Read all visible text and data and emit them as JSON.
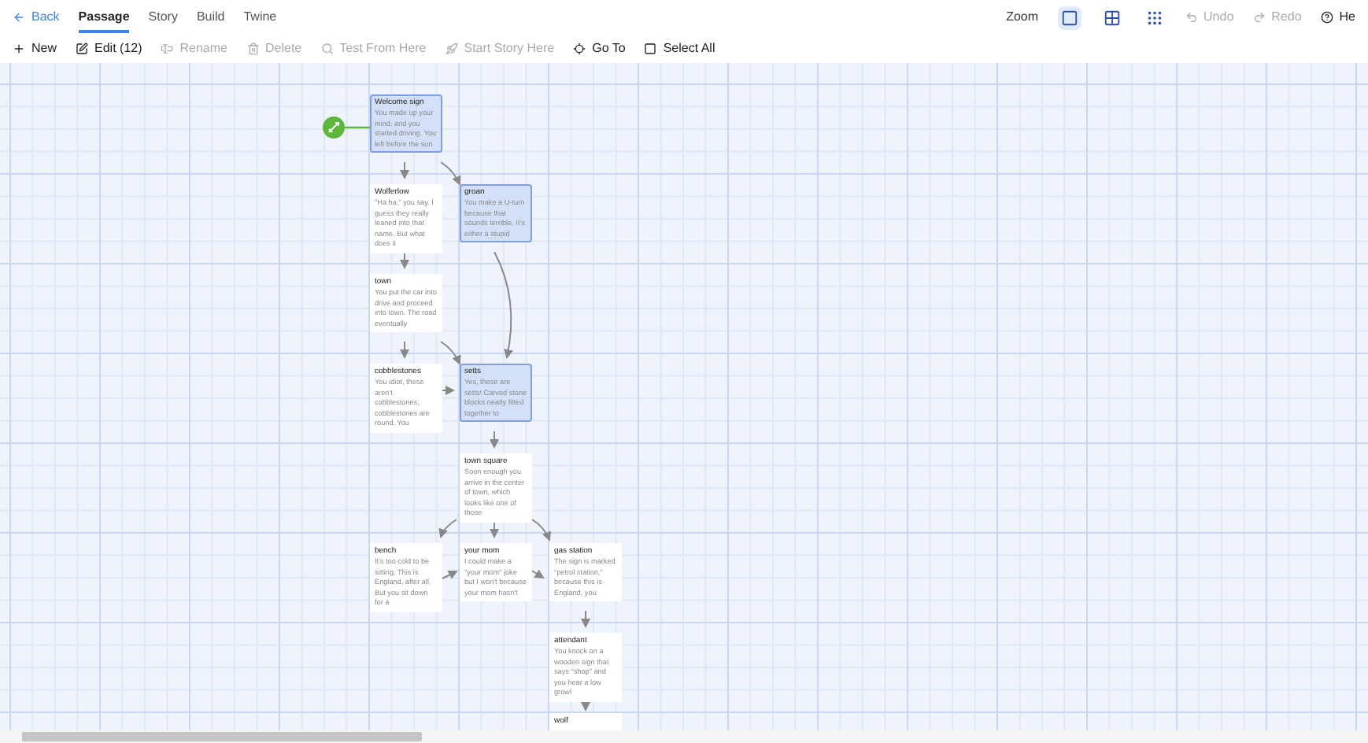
{
  "nav": {
    "back": "Back",
    "tabs": [
      {
        "label": "Passage",
        "selected": true
      },
      {
        "label": "Story",
        "selected": false
      },
      {
        "label": "Build",
        "selected": false
      },
      {
        "label": "Twine",
        "selected": false
      }
    ]
  },
  "toolbar": [
    {
      "kind": "new",
      "label": "New",
      "disabled": false
    },
    {
      "kind": "edit",
      "label": "Edit (12)",
      "disabled": false
    },
    {
      "kind": "rename",
      "label": "Rename",
      "disabled": true
    },
    {
      "kind": "delete",
      "label": "Delete",
      "disabled": true
    },
    {
      "kind": "test",
      "label": "Test From Here",
      "disabled": true
    },
    {
      "kind": "start",
      "label": "Start Story Here",
      "disabled": true
    },
    {
      "kind": "goto",
      "label": "Go To",
      "disabled": false
    },
    {
      "kind": "selectall",
      "label": "Select All",
      "disabled": false
    }
  ],
  "zoom": {
    "label": "Zoom",
    "levels": [
      {
        "kind": "large",
        "selected": true
      },
      {
        "kind": "medium",
        "selected": false
      },
      {
        "kind": "small",
        "selected": false
      }
    ]
  },
  "history": [
    {
      "kind": "undo",
      "label": "Undo",
      "disabled": true
    },
    {
      "kind": "redo",
      "label": "Redo",
      "disabled": true
    },
    {
      "kind": "help",
      "label": "He",
      "disabled": false
    }
  ],
  "passages": [
    {
      "title": "Welcome sign",
      "excerpt": "You made up your mind, and you started driving. You left before the sun",
      "selected": true
    },
    {
      "title": "Wolferlow",
      "excerpt": "\"Ha ha,\" you say. I guess they really leaned into that name. But what does it",
      "selected": false
    },
    {
      "title": "groan",
      "excerpt": "You make a U-turn because that sounds terrible. It's either a stupid",
      "selected": true
    },
    {
      "title": "town",
      "excerpt": "You put the car into drive and proceed into town. The road eventually",
      "selected": false
    },
    {
      "title": "cobblestones",
      "excerpt": "You idiot, these aren't cobblestones; cobblestones are round. You",
      "selected": false
    },
    {
      "title": "setts",
      "excerpt": "Yes, these are setts! Carved stone blocks neatly fitted together to",
      "selected": true
    },
    {
      "title": "town square",
      "excerpt": "Soon enough you arrive in the center of town, which looks like one of those",
      "selected": false
    },
    {
      "title": "bench",
      "excerpt": "It's too cold to be sitting. This is England, after all. But you sit down for a",
      "selected": false
    },
    {
      "title": "your mom",
      "excerpt": "I could make a \"your mom\" joke but I won't because your mom hasn't",
      "selected": false
    },
    {
      "title": "gas station",
      "excerpt": "The sign is marked \"petrol station,\" because this is England, you",
      "selected": false
    },
    {
      "title": "attendant",
      "excerpt": "You knock on a wooden sign that says \"shop\" and you hear a low growl",
      "selected": false
    },
    {
      "title": "wolf",
      "selected": false
    }
  ]
}
